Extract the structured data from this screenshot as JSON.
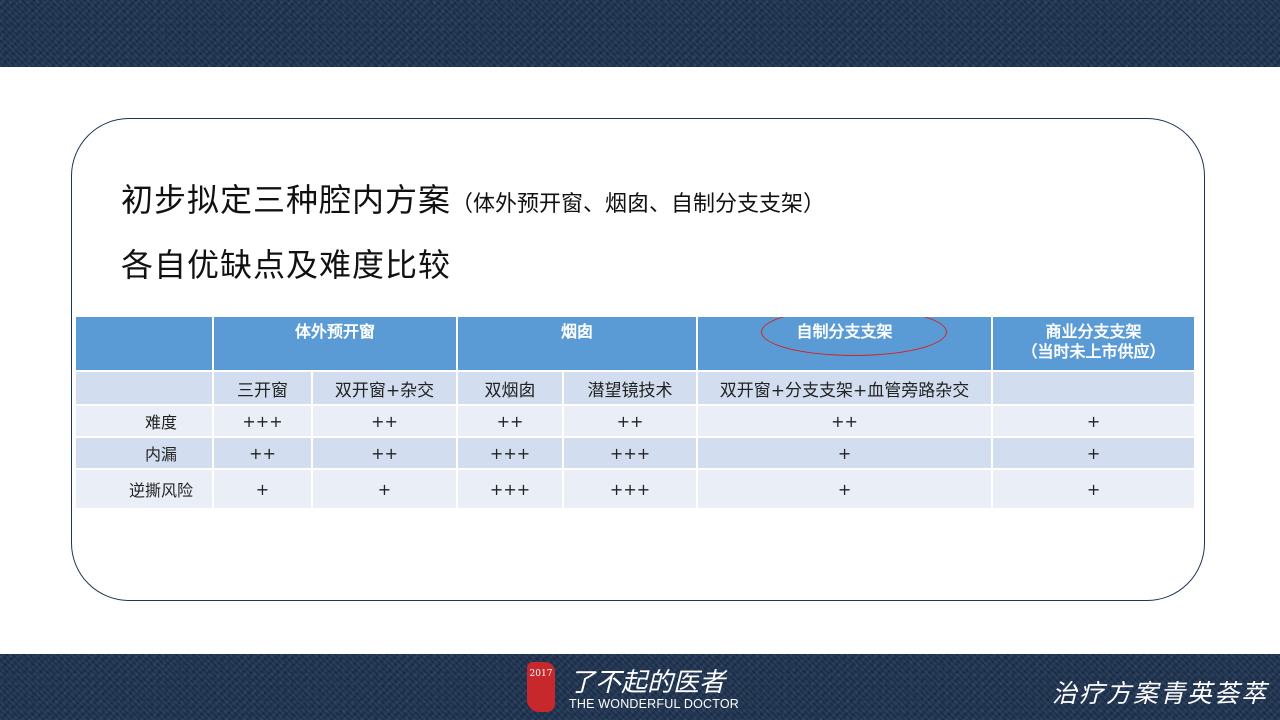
{
  "slide": {
    "title_line1": "初步拟定三种腔内方案",
    "title_line1_note": "（体外预开窗、烟囱、自制分支支架）",
    "title_line2": "各自优缺点及难度比较"
  },
  "table": {
    "header": {
      "col1": "",
      "group1": "体外预开窗",
      "group2": "烟囱",
      "group3": "自制分支支架",
      "group4_line1": "商业分支支架",
      "group4_line2": "（当时未上市供应）"
    },
    "subheader": [
      "",
      "三开窗",
      "双开窗+杂交",
      "双烟囱",
      "潜望镜技术",
      "双开窗+分支支架+血管旁路杂交",
      ""
    ],
    "rows": [
      {
        "label": "难度",
        "values": [
          "+++",
          "++",
          "++",
          "++",
          "++",
          "+"
        ]
      },
      {
        "label": "内漏",
        "values": [
          "++",
          "++",
          "+++",
          "+++",
          "+",
          "+"
        ]
      },
      {
        "label": "逆撕风险",
        "values": [
          "+",
          "+",
          "+++",
          "+++",
          "+",
          "+"
        ]
      }
    ],
    "highlight_color": "#d42020",
    "header_color": "#5b9bd5"
  },
  "footer": {
    "logo_year": "2017",
    "logo_cn": "了不起的医者",
    "logo_en": "THE WONDERFUL DOCTOR",
    "tagline": "治疗方案青英荟萃"
  }
}
